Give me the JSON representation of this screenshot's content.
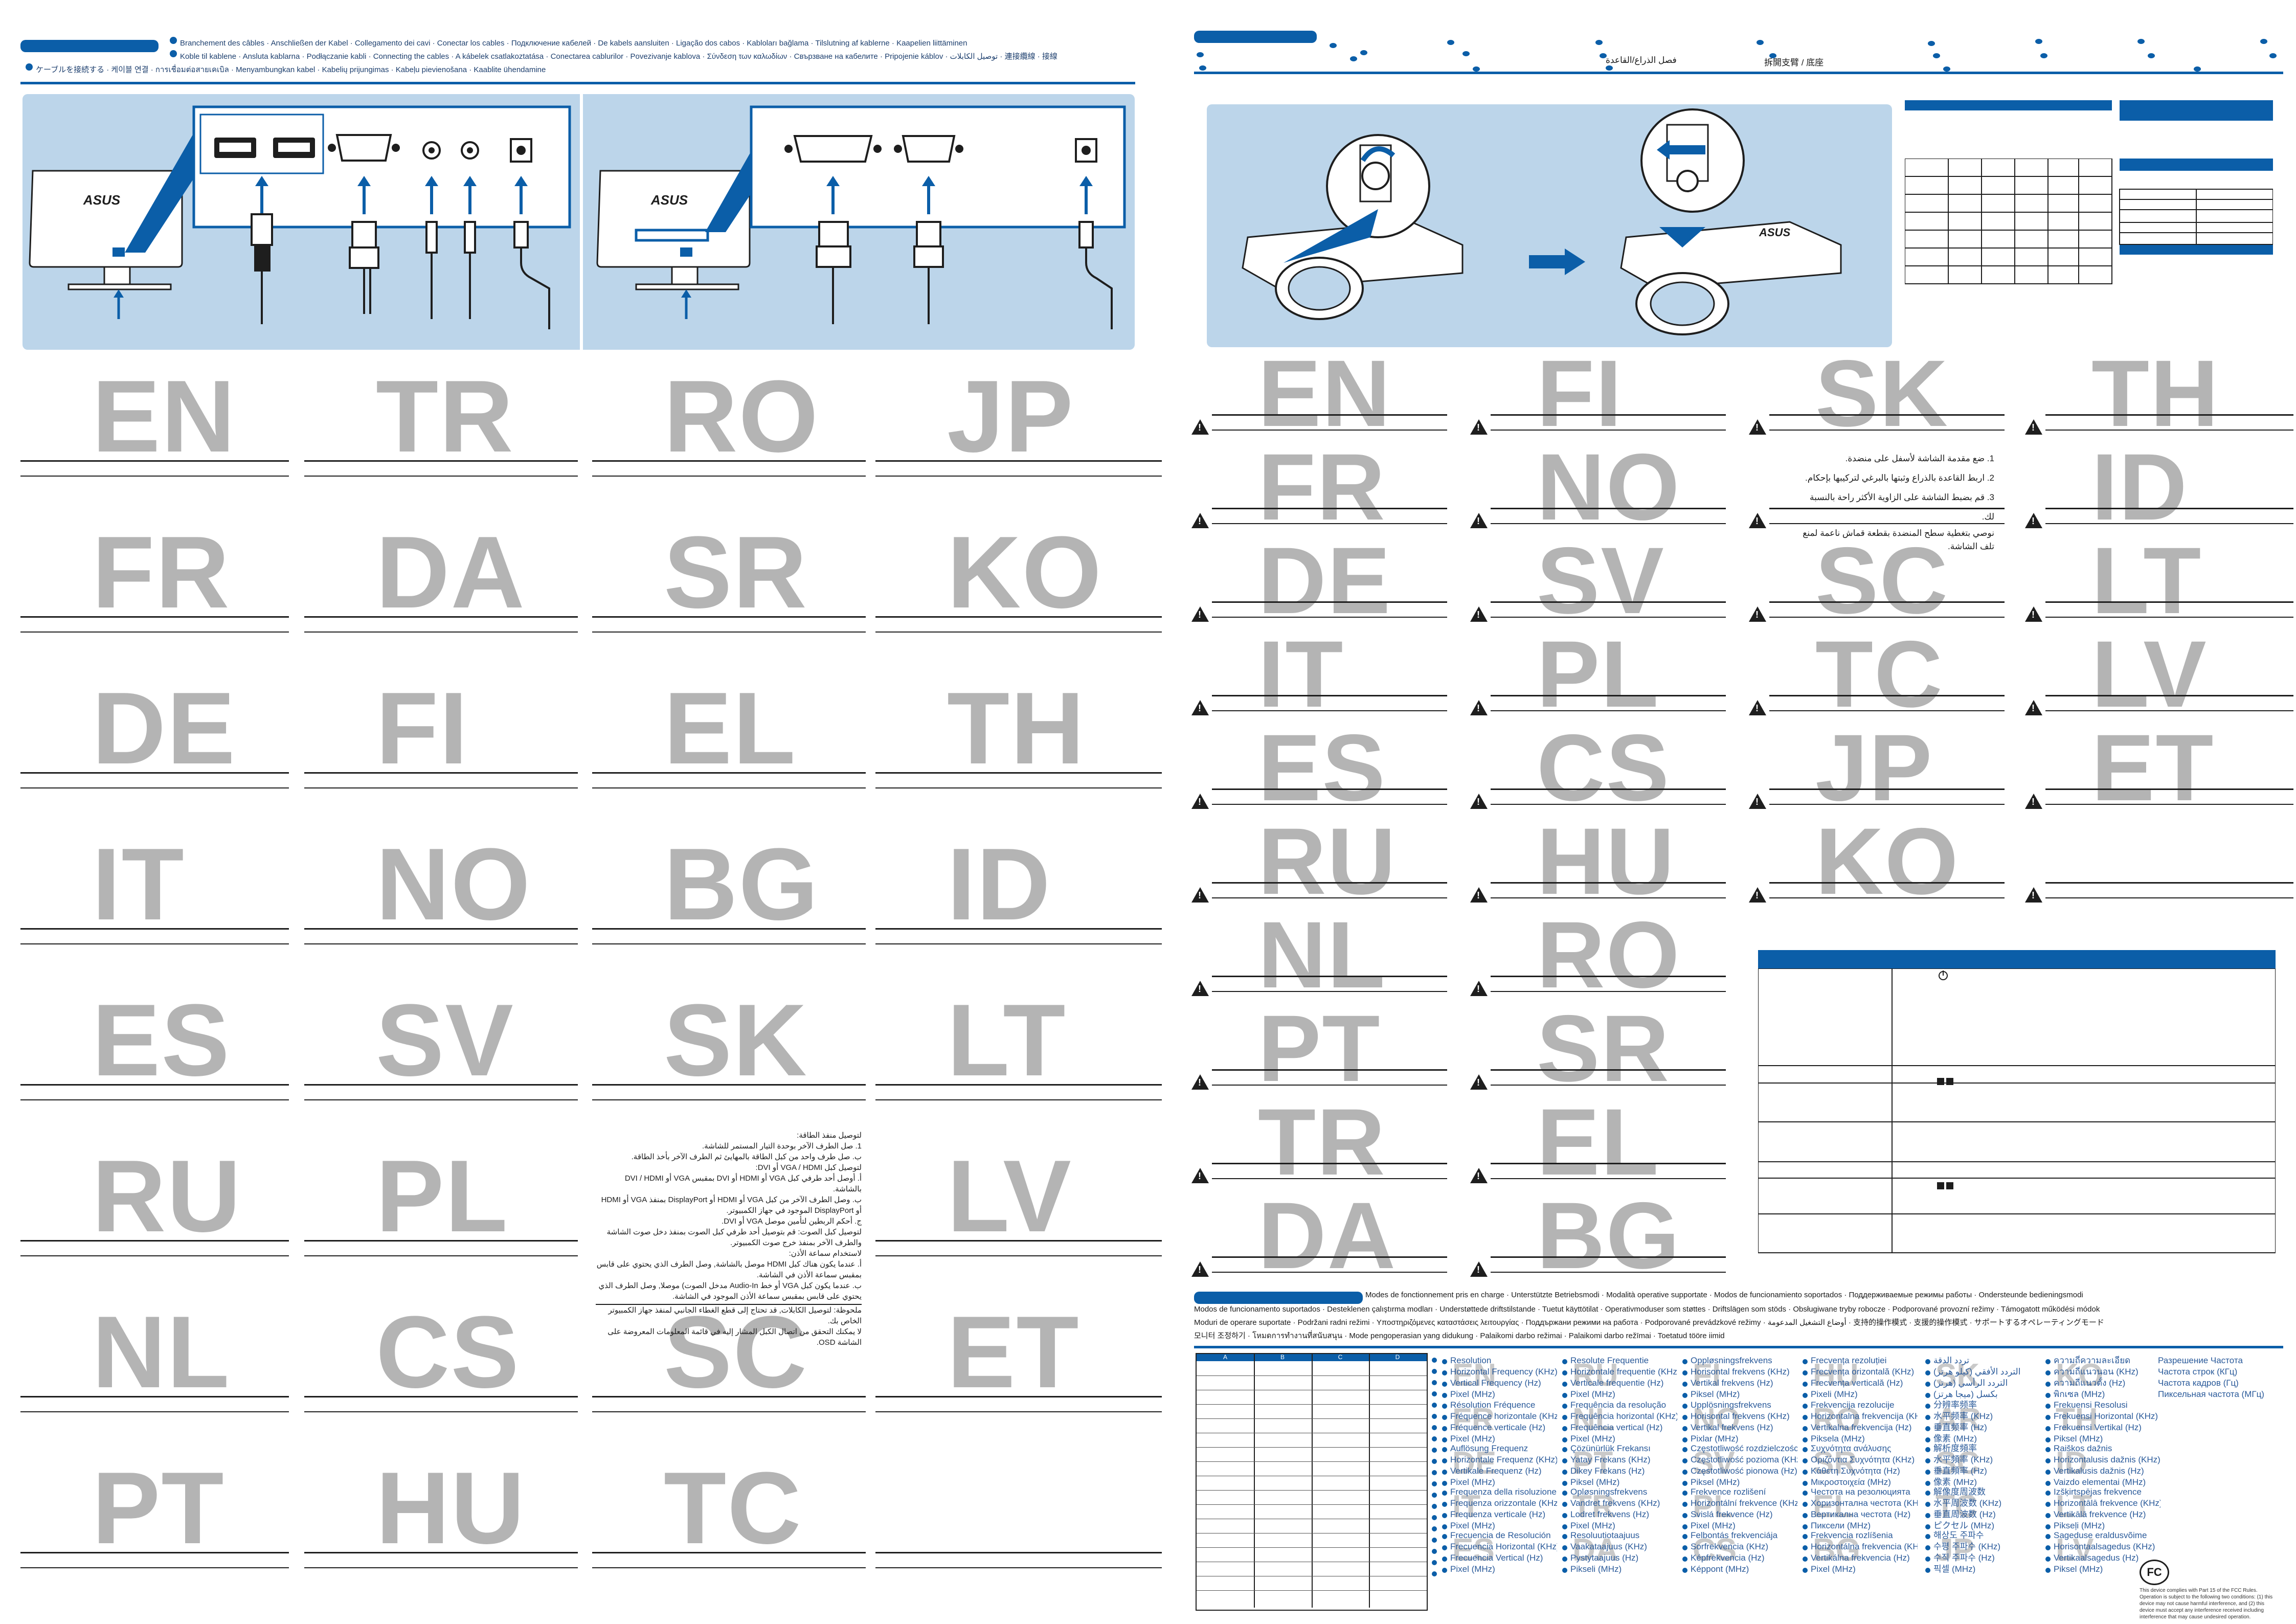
{
  "cables_header": {
    "lines": [
      "Branchement des câbles · Anschließen der Kabel · Collegamento dei cavi · Conectar los cables · Подключение кабелей · De kabels aansluiten · Ligação dos cabos · Kabloları bağlama · Tilslutning af kablerne · Kaapelien liittäminen",
      "Koble til kablene · Ansluta kablarna · Podłączanie kabli · Connecting the cables · A kábelek csatlakoztatása · Conectarea cablurilor · Povezivanje kablova · Σύνδεση των καλωδίων · Свързване на кабелите · Pripojenie káblov · توصيل الكابلات · 連接纜線 · 接線",
      "ケーブルを接続する · 케이블 연결 · การเชื่อมต่อสายเคเบิล · Menyambungkan kabel · Kabelių prijungimas · Kabeļu pievienošana · Kaablite ühendamine"
    ]
  },
  "left_codes": [
    "EN",
    "TR",
    "RO",
    "JP",
    "FR",
    "DA",
    "SR",
    "KO",
    "DE",
    "FI",
    "EL",
    "TH",
    "IT",
    "NO",
    "BG",
    "ID",
    "ES",
    "SV",
    "SK",
    "LT",
    "RU",
    "PL",
    "",
    "LV",
    "NL",
    "CS",
    "SC",
    "ET",
    "PT",
    "HU",
    "TC",
    ""
  ],
  "arabic_cables": [
    "لتوصيل منفذ الطاقة:",
    "1. صل الطرف الآخر بوحدة التيار المستمر للشاشة.",
    "ب. صل طرف واحد من كبل الطاقة بالمهايئ ثم الطرف الآخر بأخذ الطاقة.",
    "لتوصيل كبل VGA / HDMI أو DVI:",
    "أ. أوصل أحد طرفي كبل VGA أو HDMI أو DVI بمقبس VGA أو DVI / HDMI بالشاشة.",
    "ب. وصل الطرف الآخر من كبل VGA أو HDMI أو DisplayPort بمنفذ VGA أو HDMI أو DisplayPort الموجود في جهاز الكمبيوتر.",
    "ج. أحكم الربطين لتأمين موصل VGA أو DVI.",
    "لتوصيل كبل الصوت: قم بتوصيل أحد طرفي كبل الصوت بمنفذ دخل صوت الشاشة والطرف الآخر بمنفذ خرج صوت الكمبيوتر.",
    "لاستخدام سماعة الأذن:",
    "أ. عندما يكون هناك كبل HDMI موصل بالشاشة, وصل الطرف الذي يحتوي على قابس بمقبس سماعة الأذن في الشاشة.",
    "ب. عندما يكون كبل VGA أو خط Audio-In مدخل الصوت) موصلا, وصل الطرف الذي يحتوي على قابس بمقبس سماعة الأذن الموجود في الشاشة.",
    "ملحوظة: لتوصيل الكابلات, قد تحتاج إلى قطع الغطاء الجانبي لمنفذ جهاز الكمبيوتر الخاص بك.",
    "لا يمكنك التحقق من اتصال الكبل المشار إليه في قائمة المعلومات المعروضة على الشاشة OSD."
  ],
  "right_header": {
    "detach_ar": "فصل الذراع/القاعدة",
    "detach_zh": "拆開支臂 / 底座"
  },
  "right_codes_col1": [
    "EN",
    "FR",
    "DE",
    "IT",
    "ES",
    "RU",
    "NL",
    "PT",
    "TR",
    "DA"
  ],
  "right_codes_col2": [
    "FI",
    "NO",
    "SV",
    "PL",
    "CS",
    "HU",
    "RO",
    "SR",
    "EL",
    "BG"
  ],
  "right_codes_col3": [
    "SK",
    "",
    "SC",
    "TC",
    "JP",
    "KO"
  ],
  "right_codes_col4": [
    "TH",
    "ID",
    "LT",
    "LV",
    "ET"
  ],
  "arabic_detach": [
    "1. ضع مقدمة الشاشة لأسفل على منضدة.",
    "2. اربط القاعدة بالذراع وثبتها بالبرغي لتركيبها بإحكام.",
    "3. قم بضبط الشاشة على الزاوية الأكثر راحة بالنسبة لك.",
    "نوصي بتغطية سطح المنضدة بقطعة قماش ناعمة لمنع تلف الشاشة."
  ],
  "modes_header": {
    "lines": [
      "Modes de fonctionnement pris en charge · Unterstützte Betriebsmodi · Modalità operative supportate · Modos de funcionamiento soportados · Поддерживаемые режимы работы · Ondersteunde bedieningsmodi",
      "Modos de funcionamento suportados · Desteklenen çalıştırma modları · Understøttede driftstilstande · Tuetut käyttötilat · Operativmoduser som støttes · Driftslägen som stöds · Obsługiwane tryby robocze · Podporované provozní režimy · Támogatott működési módok",
      "Moduri de operare suportate · Podržani radni režimi · Υποστηριζόμενες καταστάσεις λειτουργίας · Поддържани режими на работа · Podporované prevádzkové režimy · أوضاع التشغيل المدعومة · 支持的操作模式 · 支援的操作模式 · サポートするオペレーティングモード",
      "모니터 조정하기 · โหมดการทำงานที่สนับสนุน · Mode pengoperasian yang didukung · Palaikomi darbo režimai · Palaikomi darbo režīmai · Toetatud tööre iimid"
    ]
  },
  "table_cols": [
    "A",
    "B",
    "C",
    "D"
  ],
  "spec_lang_codes": [
    "EN",
    "FR",
    "DE",
    "IT",
    "ES",
    "RU",
    "NL",
    "PT",
    "TR",
    "DA",
    "FI",
    "NO",
    "SV",
    "PL",
    "CS",
    "HU",
    "RO",
    "SR",
    "EL",
    "BG",
    "SK",
    "AR",
    "SC",
    "TC",
    "JP",
    "KO",
    "TH",
    "ID",
    "LT",
    "LV",
    "ET"
  ],
  "specs": [
    [
      "Resolution",
      "Horizontal Frequency (KHz)",
      "Vertical Frequency (Hz)",
      "Pixel (MHz)"
    ],
    [
      "Résolution Fréquence",
      "Fréquence horizontale (KHz)",
      "Fréquence verticale (Hz)",
      "Pixel (MHz)"
    ],
    [
      "Auflösung Frequenz",
      "Horizontale Frequenz (KHz)",
      "Vertikale Frequenz (Hz)",
      "Pixel (MHz)"
    ],
    [
      "Frequenza della risoluzione",
      "Frequenza orizzontale (KHz)",
      "Frequenza verticale (Hz)",
      "Pixel (MHz)"
    ],
    [
      "Frecuencia de Resolución",
      "Frecuencia Horizontal (KHz)",
      "Frecuencia Vertical (Hz)",
      "Pixel (MHz)"
    ],
    [
      "Resolute Frequentie",
      "Horizontale frequentie (KHz)",
      "Verticale frequentie (Hz)",
      "Pixel (MHz)"
    ],
    [
      "Frequência da resolução",
      "Frequência horizontal (KHz)",
      "Frequência vertical (Hz)",
      "Pixel (MHz)"
    ],
    [
      "Çözünürlük Frekansı",
      "Yatay Frekans (KHz)",
      "Dikey Frekans (Hz)",
      "Piksel (MHz)"
    ],
    [
      "Opløsningsfrekvens",
      "Vandret frekvens (KHz)",
      "Lodret frekvens (Hz)",
      "Pixel (MHz)"
    ],
    [
      "Resoluutiotaajuus",
      "Vaakataajuus (KHz)",
      "Pystytaajuus (Hz)",
      "Pikseli (MHz)"
    ],
    [
      "Oppløsningsfrekvens",
      "Horisontal frekvens (KHz)",
      "Vertikal frekvens (Hz)",
      "Piksel (MHz)"
    ],
    [
      "Upplösningsfrekvens",
      "Horisontal frekvens (KHz)",
      "Vertikal frekvens (Hz)",
      "Pixlar (MHz)"
    ],
    [
      "Częstotliwość rozdzielczości",
      "Częstotliwość pozioma (KHz)",
      "Częstotliwość pionowa (Hz)",
      "Piksel (MHz)"
    ],
    [
      "Frekvence rozlišení",
      "Horizontální frekvence (KHz)",
      "Svislá frekvence (Hz)",
      "Pixel (MHz)"
    ],
    [
      "Felbontás frekvenciája",
      "Sorfrekvencia (KHz)",
      "Képfrekvencia (Hz)",
      "Képpont (MHz)"
    ],
    [
      "Frecvența rezoluției",
      "Frecvența orizontală (KHz)",
      "Frecvența verticală (Hz)",
      "Pixeli (MHz)"
    ],
    [
      "Frekvencija rezolucije",
      "Horizontalna frekvencija (KHz)",
      "Vertikalna frekvencija (Hz)",
      "Piksela (MHz)"
    ],
    [
      "Συχνότητα ανάλυσης",
      "Οριζόντια Συχνότητα (KHz)",
      "Κάθετη Συχνότητα (Hz)",
      "Μικροστοιχεία (MHz)"
    ],
    [
      "Честота на резолюцията",
      "Хоризонтална честота (KHz)",
      "Вертикална честота (Hz)",
      "Пиксели (MHz)"
    ],
    [
      "Frekvencia rozlíšenia",
      "Horizontálna frekvencia (KHz)",
      "Vertikálna frekvencia (Hz)",
      "Pixel (MHz)"
    ],
    [
      "تردد الدقة",
      "التردد الأفقي (كيلو هرتز)",
      "التردد الرأسي (هرتز)",
      "بكسل (ميجا هرتز)"
    ],
    [
      "分辨率频率",
      "水平频率 (KHz)",
      "垂直频率 (Hz)",
      "像素 (MHz)"
    ],
    [
      "解析度頻率",
      "水平頻率 (KHz)",
      "垂直頻率 (Hz)",
      "像素 (MHz)"
    ],
    [
      "解像度周波数",
      "水平周波数 (KHz)",
      "垂直周波数 (Hz)",
      "ピクセル (MHz)"
    ],
    [
      "해상도 주파수",
      "수평 주파수 (KHz)",
      "수직 주파수 (Hz)",
      "픽셀 (MHz)"
    ],
    [
      "ความถี่ความละเอียด",
      "ความถี่แนวนอน (KHz)",
      "ความถี่แนวตั้ง (Hz)",
      "พิกเซล (MHz)"
    ],
    [
      "Frekuensi Resolusi",
      "Frekuensi Horizontal (KHz)",
      "Frekuensi Vertikal (Hz)",
      "Piksel (MHz)"
    ],
    [
      "Raiškos dažnis",
      "Horizontalusis dažnis (KHz)",
      "Vertikalusis dažnis (Hz)",
      "Vaizdo elementai (MHz)"
    ],
    [
      "Izšķirtspējas frekvence",
      "Horizontālā frekvence (KHz)",
      "Vertikālā frekvence (Hz)",
      "Pikseļi (MHz)"
    ],
    [
      "Sageduse eraldusvõime",
      "Horisontaalsagedus (KHz)",
      "Vertikaalsagedus (Hz)",
      "Piksel (MHz)"
    ],
    [
      "Разрешение Частота",
      "Частота строк (КГц)",
      "Частота кадров (Гц)",
      "Пиксельная частота (МГц)"
    ]
  ],
  "fcc_text": "This device complies with Part 15 of the FCC Rules. Operation is subject to the following two conditions: (1) this device may not cause harmful interference, and (2) this device must accept any interference received including interference that may cause undesired operation.",
  "fcc_logo": "FC",
  "brand": "ASUS"
}
